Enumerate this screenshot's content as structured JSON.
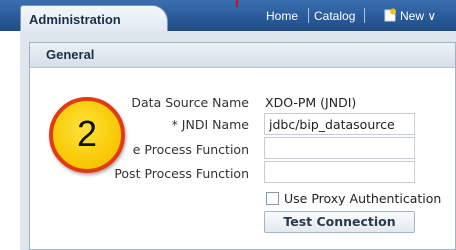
{
  "header": {
    "active_tab": "Administration",
    "nav": {
      "home": "Home",
      "catalog": "Catalog",
      "new": "New ∨"
    }
  },
  "panel": {
    "title": "General",
    "data_source_name_label": "Data Source Name",
    "data_source_name_value": "XDO-PM (JNDI)",
    "jndi_name_label": "* JNDI Name",
    "jndi_name_value": "jdbc/bip_datasource",
    "pre_process_label": "e Process Function",
    "pre_process_value": "",
    "post_process_label": "Post Process Function",
    "post_process_value": "",
    "use_proxy_label": "Use Proxy Authentication",
    "use_proxy_checked": false,
    "test_connection_label": "Test Connection"
  },
  "callout": {
    "number": "2"
  },
  "colors": {
    "header_blue": "#2a5b9a",
    "badge_yellow": "#f7c600",
    "badge_border": "#e23a14"
  }
}
